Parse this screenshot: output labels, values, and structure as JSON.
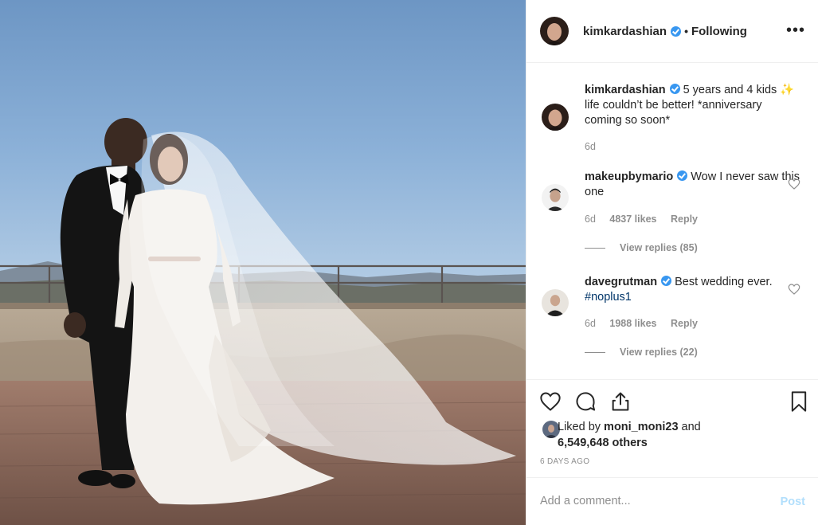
{
  "header": {
    "username": "kimkardashian",
    "separator": "•",
    "follow_status": "Following",
    "more_label": "•••"
  },
  "caption": {
    "username": "kimkardashian",
    "text_1": "5 years and 4 kids",
    "emoji": "✨",
    "text_2": "life couldn’t be better! *anniversary coming so soon*",
    "time": "6d"
  },
  "comments": [
    {
      "username": "makeupbymario",
      "text": "Wow I never saw this one",
      "time": "6d",
      "likes": "4837 likes",
      "reply": "Reply",
      "view_replies": "View replies (85)"
    },
    {
      "username": "davegrutman",
      "text": "Best wedding ever. ",
      "hashtag": "#noplus1",
      "time": "6d",
      "likes": "1988 likes",
      "reply": "Reply",
      "view_replies": "View replies (22)"
    }
  ],
  "icons": {
    "like": "heart-icon",
    "comment": "speech-bubble-icon",
    "share": "share-icon",
    "save": "bookmark-icon"
  },
  "likes": {
    "prefix": "Liked by ",
    "user": "moni_moni23",
    "joiner": " and ",
    "others": "6,549,648 others"
  },
  "timestamp": "6 DAYS AGO",
  "add_comment": {
    "placeholder": "Add a comment...",
    "post_label": "Post"
  },
  "colors": {
    "accent": "#3897f0",
    "post_disabled": "#b2dffc",
    "muted": "#8e8e8e",
    "text": "#262626"
  }
}
